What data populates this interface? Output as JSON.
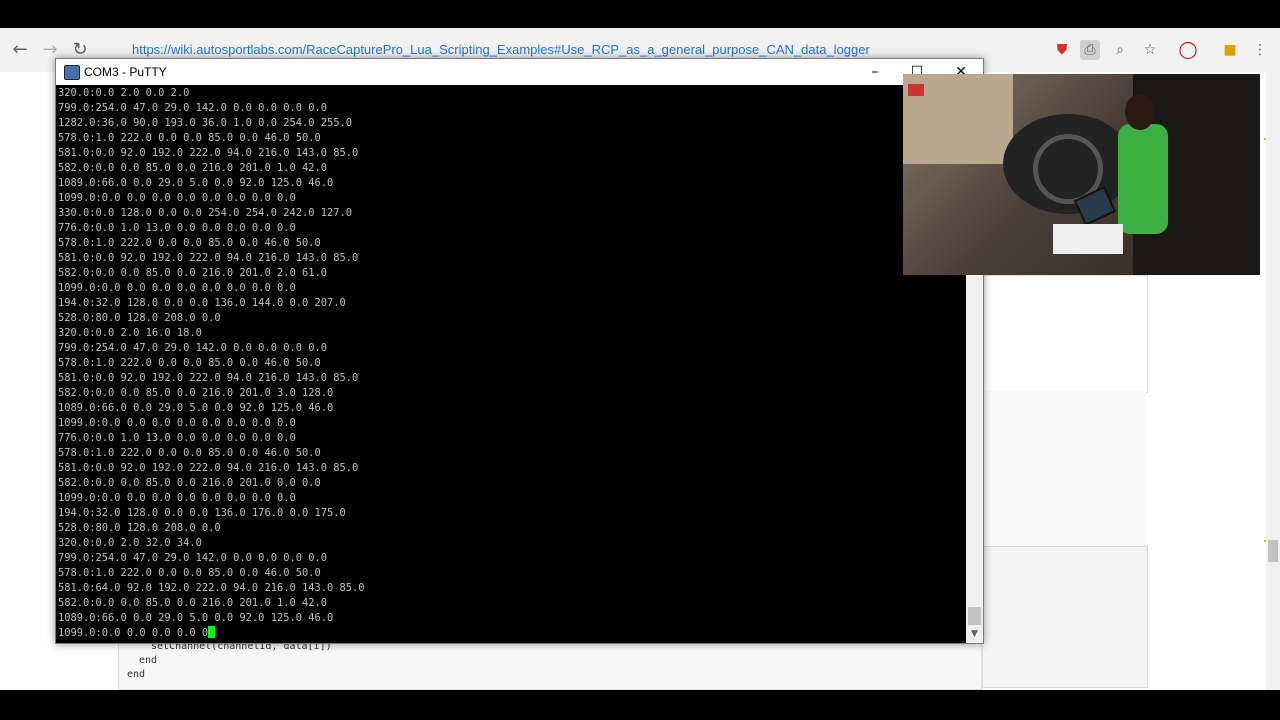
{
  "browser": {
    "url": "https://wiki.autosportlabs.com/RaceCapturePro_Lua_Scripting_Examples#Use_RCP_as_a_general_purpose_CAN_data_logger",
    "back_icon": "arrow-left-icon",
    "forward_icon": "arrow-right-icon",
    "reload_icon": "reload-icon"
  },
  "putty": {
    "title": "COM3 - PuTTY",
    "minimize_glyph": "–",
    "maximize_glyph": "☐",
    "close_glyph": "✕"
  },
  "terminal": {
    "lines": [
      "320.0:0.0 2.0 0.0 2.0",
      "799.0:254.0 47.0 29.0 142.0 0.0 0.0 0.0 0.0",
      "1282.0:36.0 90.0 193.0 36.0 1.0 0.0 254.0 255.0",
      "578.0:1.0 222.0 0.0 0.0 85.0 0.0 46.0 50.0",
      "581.0:0.0 92.0 192.0 222.0 94.0 216.0 143.0 85.0",
      "582.0:0.0 0.0 85.0 0.0 216.0 201.0 1.0 42.0",
      "1089.0:66.0 0.0 29.0 5.0 0.0 92.0 125.0 46.0",
      "1099.0:0.0 0.0 0.0 0.0 0.0 0.0 0.0 0.0",
      "330.0:0.0 128.0 0.0 0.0 254.0 254.0 242.0 127.0",
      "776.0:0.0 1.0 13.0 0.0 0.0 0.0 0.0 0.0",
      "578.0:1.0 222.0 0.0 0.0 85.0 0.0 46.0 50.0",
      "581.0:0.0 92.0 192.0 222.0 94.0 216.0 143.0 85.0",
      "582.0:0.0 0.0 85.0 0.0 216.0 201.0 2.0 61.0",
      "1099.0:0.0 0.0 0.0 0.0 0.0 0.0 0.0 0.0",
      "194.0:32.0 128.0 0.0 0.0 136.0 144.0 0.0 207.0",
      "528.0:80.0 128.0 208.0 0.0",
      "320.0:0.0 2.0 16.0 18.0",
      "799.0:254.0 47.0 29.0 142.0 0.0 0.0 0.0 0.0",
      "578.0:1.0 222.0 0.0 0.0 85.0 0.0 46.0 50.0",
      "581.0:0.0 92.0 192.0 222.0 94.0 216.0 143.0 85.0",
      "582.0:0.0 0.0 85.0 0.0 216.0 201.0 3.0 128.0",
      "1089.0:66.0 0.0 29.0 5.0 0.0 92.0 125.0 46.0",
      "1099.0:0.0 0.0 0.0 0.0 0.0 0.0 0.0 0.0",
      "776.0:0.0 1.0 13.0 0.0 0.0 0.0 0.0 0.0",
      "578.0:1.0 222.0 0.0 0.0 85.0 0.0 46.0 50.0",
      "581.0:0.0 92.0 192.0 222.0 94.0 216.0 143.0 85.0",
      "582.0:0.0 0.0 85.0 0.0 216.0 201.0 0.0 0.0",
      "1099.0:0.0 0.0 0.0 0.0 0.0 0.0 0.0 0.0",
      "194.0:32.0 128.0 0.0 0.0 136.0 176.0 0.0 175.0",
      "528.0:80.0 128.0 208.0 0.0",
      "320.0:0.0 2.0 32.0 34.0",
      "799.0:254.0 47.0 29.0 142.0 0.0 0.0 0.0 0.0",
      "578.0:1.0 222.0 0.0 0.0 85.0 0.0 46.0 50.0",
      "581.0:64.0 92.0 192.0 222.0 94.0 216.0 143.0 85.0",
      "582.0:0.0 0.0 85.0 0.0 216.0 201.0 1.0 42.0",
      "1089.0:66.0 0.0 29.0 5.0 0.0 92.0 125.0 46.0"
    ],
    "last_line": "1099.0:0.0 0.0 0.0 0.0 0",
    "text_color": "#c0c0c0",
    "cursor_color": "#00ff00"
  },
  "code_snippet": {
    "line1": "setChannel(channelId, data[i])",
    "line2": "end",
    "line3": "end"
  },
  "colors": {
    "accent": "#f5b400",
    "link": "#1a73e8"
  }
}
